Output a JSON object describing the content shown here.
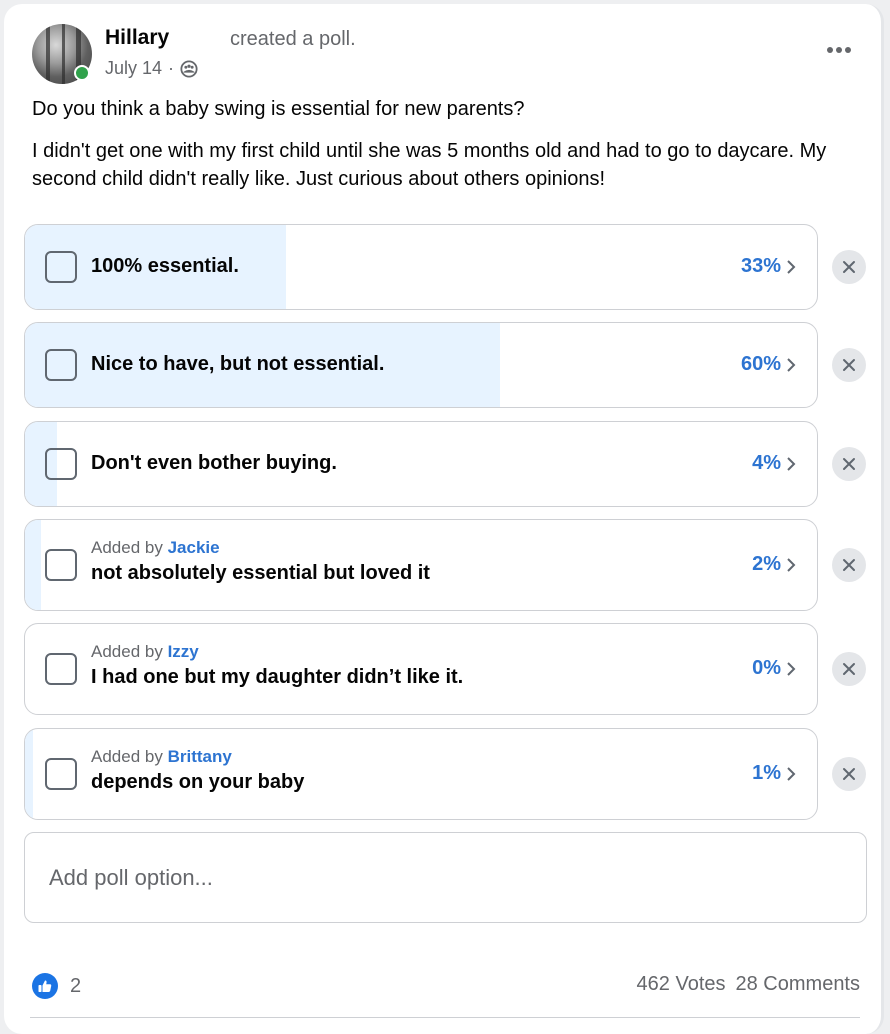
{
  "post": {
    "author": "Hillary",
    "action": "created a poll.",
    "date": "July 14",
    "separator": "·",
    "audience_icon": "group-members-icon",
    "online": true,
    "more_icon": "more-options-icon"
  },
  "poll": {
    "question": "Do you think a baby swing is essential for new parents?",
    "description": "I didn't get one with my first child until she was 5 months old and had to go to daycare. My second child didn't really like. Just curious about others opinions!",
    "added_by_prefix": "Added by",
    "options": [
      {
        "label": "100% essential.",
        "percent": 33,
        "percent_label": "33%",
        "added_by": null
      },
      {
        "label": "Nice to have, but not essential.",
        "percent": 60,
        "percent_label": "60%",
        "added_by": null
      },
      {
        "label": "Don't even bother buying.",
        "percent": 4,
        "percent_label": "4%",
        "added_by": null
      },
      {
        "label": "not absolutely essential but loved it",
        "percent": 2,
        "percent_label": "2%",
        "added_by": "Jackie"
      },
      {
        "label": "I had one but my daughter didn’t like it.",
        "percent": 0,
        "percent_label": "0%",
        "added_by": "Izzy"
      },
      {
        "label": "depends on your baby",
        "percent": 1,
        "percent_label": "1%",
        "added_by": "Brittany"
      }
    ],
    "add_option_placeholder": "Add poll option..."
  },
  "footer": {
    "reaction_icon": "like-icon",
    "reaction_count": "2",
    "votes": "462 Votes",
    "comments": "28 Comments"
  },
  "colors": {
    "accent": "#2d74d1",
    "fill": "#e7f3ff",
    "online": "#31a24c",
    "like": "#1b74e4"
  }
}
